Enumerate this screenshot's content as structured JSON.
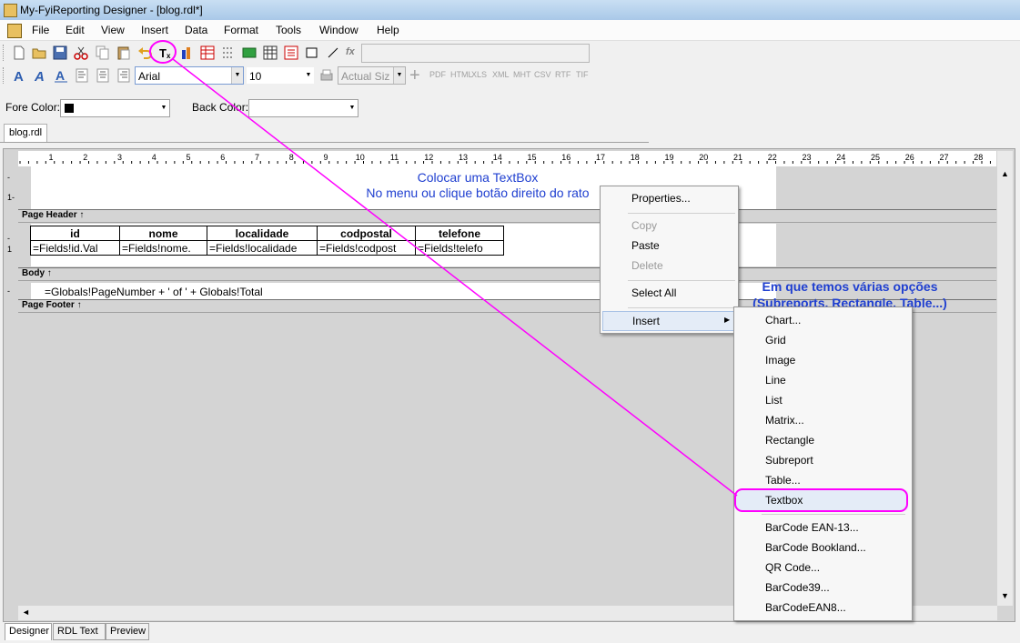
{
  "window": {
    "title": "My-FyiReporting Designer - [blog.rdl*]"
  },
  "menu": [
    "File",
    "Edit",
    "View",
    "Insert",
    "Data",
    "Format",
    "Tools",
    "Window",
    "Help"
  ],
  "toolbar": {
    "font_name": "Arial",
    "font_size": "10",
    "zoom": "Actual Siz",
    "export_formats": [
      "PDF",
      "HTML",
      "XLS",
      "XML",
      "MHT",
      "CSV",
      "RTF",
      "TIF"
    ],
    "fx_label": "fx",
    "expression": ""
  },
  "colors_row": {
    "fore_label": "Fore Color:",
    "back_label": "Back Color:",
    "fore_value": "#000000"
  },
  "doc_tab": "blog.rdl",
  "ruler_numbers": [
    "1",
    "2",
    "3",
    "4",
    "5",
    "6",
    "7",
    "8",
    "9",
    "10",
    "11",
    "12",
    "13",
    "14",
    "15",
    "16",
    "17",
    "18",
    "19",
    "20",
    "21",
    "22",
    "23",
    "24",
    "25",
    "26",
    "27",
    "28"
  ],
  "design": {
    "note_line1": "Colocar uma TextBox",
    "note_line2": "No menu ou clique botão direito do rato",
    "bands": {
      "header": "Page Header ↑",
      "body": "Body ↑",
      "footer": "Page Footer ↑"
    },
    "table_headers": [
      "id",
      "nome",
      "localidade",
      "codpostal",
      "telefone"
    ],
    "table_fields": [
      "=Fields!id.Val",
      "=Fields!nome.",
      "=Fields!localidade",
      "=Fields!codpost",
      "=Fields!telefo"
    ],
    "footer_expr": "=Globals!PageNumber + ' of ' + Globals!Total"
  },
  "annotation": {
    "line1": "Em que temos várias opções",
    "line2": "(Subreports, Rectangle, Table...)"
  },
  "context_menu": {
    "properties": "Properties...",
    "copy": "Copy",
    "paste": "Paste",
    "delete": "Delete",
    "select_all": "Select All",
    "insert": "Insert"
  },
  "insert_menu": [
    "Chart...",
    "Grid",
    "Image",
    "Line",
    "List",
    "Matrix...",
    "Rectangle",
    "Subreport",
    "Table...",
    "Textbox",
    "BarCode EAN-13...",
    "BarCode Bookland...",
    "QR Code...",
    "BarCode39...",
    "BarCodeEAN8..."
  ],
  "bottom_tabs": [
    "Designer",
    "RDL Text",
    "Preview"
  ],
  "highlight_color": "#ff00ff"
}
